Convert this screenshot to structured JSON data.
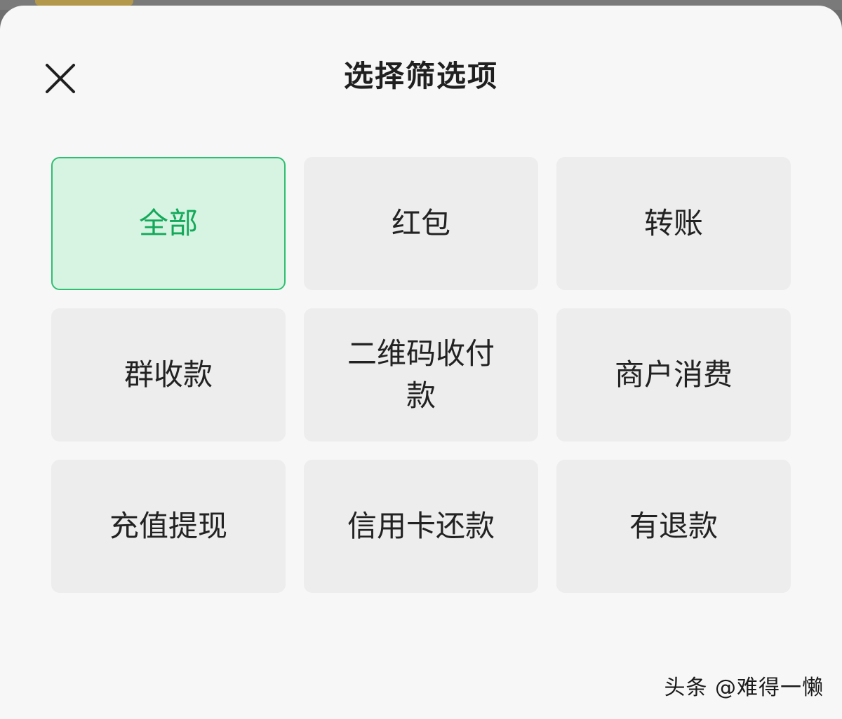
{
  "header": {
    "title": "选择筛选项",
    "close_icon": "close-icon"
  },
  "filter_options": [
    {
      "label": "全部",
      "selected": true
    },
    {
      "label": "红包",
      "selected": false
    },
    {
      "label": "转账",
      "selected": false
    },
    {
      "label": "群收款",
      "selected": false
    },
    {
      "label": "二维码收付款",
      "selected": false
    },
    {
      "label": "商户消费",
      "selected": false
    },
    {
      "label": "充值提现",
      "selected": false
    },
    {
      "label": "信用卡还款",
      "selected": false
    },
    {
      "label": "有退款",
      "selected": false
    }
  ],
  "watermark": "头条 @难得一懒",
  "colors": {
    "accent": "#14a95a",
    "selected_bg": "#d7f4e3",
    "tile_bg": "#ededed",
    "sheet_bg": "#f7f7f7"
  }
}
